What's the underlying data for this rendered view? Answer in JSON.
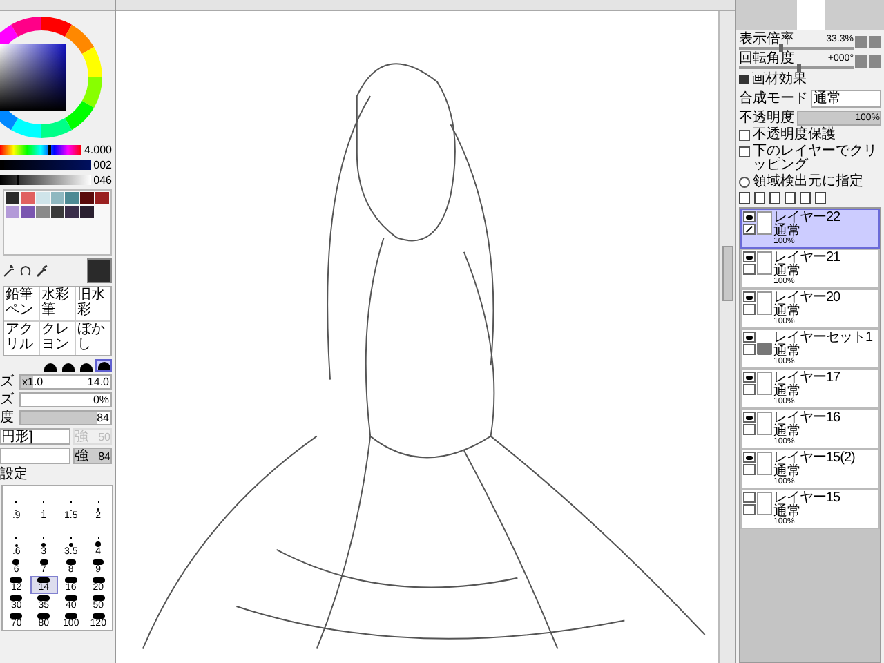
{
  "color_panel": {
    "sliders": [
      {
        "kind": "hue",
        "level": 0.6,
        "reading": "4.000"
      },
      {
        "kind": "dark",
        "level": 0.02,
        "reading": "002"
      },
      {
        "kind": "gray",
        "level": 0.18,
        "reading": "046"
      }
    ],
    "swatches": [
      {
        "color": "#2a2a2a"
      },
      {
        "color": "#e06060"
      },
      {
        "color": "#cfe4ea"
      },
      {
        "color": "#8fb8c0"
      },
      {
        "color": "#4e8a94"
      },
      {
        "color": "#5a0a0a"
      },
      {
        "color": "#9a2020"
      },
      {
        "color": "#b39ad8"
      },
      {
        "color": "#7a56b0"
      },
      {
        "color": "#8a8a8a"
      },
      {
        "color": "#3a3a3a"
      },
      {
        "color": "#3a2e4a"
      },
      {
        "color": "#2a2030"
      }
    ]
  },
  "tools": [
    {
      "name": "鉛筆ペン"
    },
    {
      "name": "水彩筆"
    },
    {
      "name": "旧水彩"
    },
    {
      "name": "アクリル"
    },
    {
      "name": "クレヨン"
    },
    {
      "name": "ぼかし"
    }
  ],
  "brush_tips": [
    {
      "selected": false
    },
    {
      "selected": false
    },
    {
      "selected": false
    },
    {
      "selected": true
    }
  ],
  "brush_settings": {
    "size": {
      "label": "ズ",
      "multiplier": "x1.0",
      "value": "14.0",
      "level": 0.14
    },
    "min_size": {
      "label": "ズ",
      "value": "0%",
      "level": 0
    },
    "density": {
      "label": "度",
      "value": "84",
      "level": 0.84
    },
    "shape": {
      "value": "円形]"
    },
    "shape_strength": {
      "label": "強",
      "value": "50",
      "disabled": true
    },
    "texture_strength": {
      "label": "強",
      "value": "84",
      "disabled": false
    },
    "section": "設定"
  },
  "size_presets": [
    {
      "selected": false
    },
    {
      "selected": false
    },
    {
      "selected": false
    },
    {
      "selected": false
    },
    {
      "label": ".9",
      "selected": false
    },
    {
      "label": "1",
      "selected": false
    },
    {
      "label": "1.5",
      "selected": false
    },
    {
      "label": "2",
      "selected": false
    },
    {
      "selected": false
    },
    {
      "selected": false
    },
    {
      "selected": false
    },
    {
      "selected": false
    },
    {
      "label": ".6",
      "selected": false
    },
    {
      "label": "3",
      "selected": false
    },
    {
      "label": "3.5",
      "selected": false
    },
    {
      "label": "4",
      "selected": false
    },
    {
      "label": "6",
      "selected": false
    },
    {
      "label": "7",
      "selected": false
    },
    {
      "label": "8",
      "selected": false
    },
    {
      "label": "9",
      "selected": false
    },
    {
      "label": "12",
      "selected": false
    },
    {
      "label": "14",
      "selected": true
    },
    {
      "label": "16",
      "selected": false
    },
    {
      "label": "20",
      "selected": false
    },
    {
      "label": "30",
      "selected": false
    },
    {
      "label": "35",
      "selected": false
    },
    {
      "label": "40",
      "selected": false
    },
    {
      "label": "50",
      "selected": false
    },
    {
      "label": "70",
      "selected": false
    },
    {
      "label": "80",
      "selected": false
    },
    {
      "label": "100",
      "selected": false
    },
    {
      "label": "120",
      "selected": false
    }
  ],
  "navigator": {
    "zoom": {
      "label": "表示倍率",
      "value": "33.3%",
      "level": 0.35
    },
    "rotation": {
      "label": "回転角度",
      "value": "+000°",
      "level": 0.5
    }
  },
  "layer_props": {
    "effects": "画材効果",
    "blend": {
      "label": "合成モード",
      "value": "通常"
    },
    "opacity": {
      "label": "不透明度",
      "value": "100%",
      "level": 1
    },
    "options": [
      {
        "kind": "checkbox",
        "label": "不透明度保護",
        "checked": false
      },
      {
        "kind": "checkbox",
        "label": "下のレイヤーでクリッピング",
        "checked": false
      },
      {
        "kind": "radio",
        "label": "領域検出元に指定",
        "checked": false
      }
    ]
  },
  "layers": [
    {
      "kind": "layer",
      "name": "レイヤー22",
      "mode": "通常",
      "opacity": "100%",
      "visible": true,
      "selected": true
    },
    {
      "kind": "layer",
      "name": "レイヤー21",
      "mode": "通常",
      "opacity": "100%",
      "visible": true,
      "selected": false
    },
    {
      "kind": "layer",
      "name": "レイヤー20",
      "mode": "通常",
      "opacity": "100%",
      "visible": true,
      "selected": false
    },
    {
      "kind": "folder",
      "name": "レイヤーセット1",
      "mode": "通常",
      "opacity": "100%",
      "visible": true,
      "selected": false
    },
    {
      "kind": "layer",
      "name": "レイヤー17",
      "mode": "通常",
      "opacity": "100%",
      "visible": true,
      "selected": false
    },
    {
      "kind": "layer",
      "name": "レイヤー16",
      "mode": "通常",
      "opacity": "100%",
      "visible": true,
      "selected": false
    },
    {
      "kind": "layer",
      "name": "レイヤー15(2)",
      "mode": "通常",
      "opacity": "100%",
      "visible": true,
      "selected": false
    },
    {
      "kind": "layer",
      "name": "レイヤー15",
      "mode": "通常",
      "opacity": "100%",
      "visible": false,
      "selected": false
    }
  ]
}
